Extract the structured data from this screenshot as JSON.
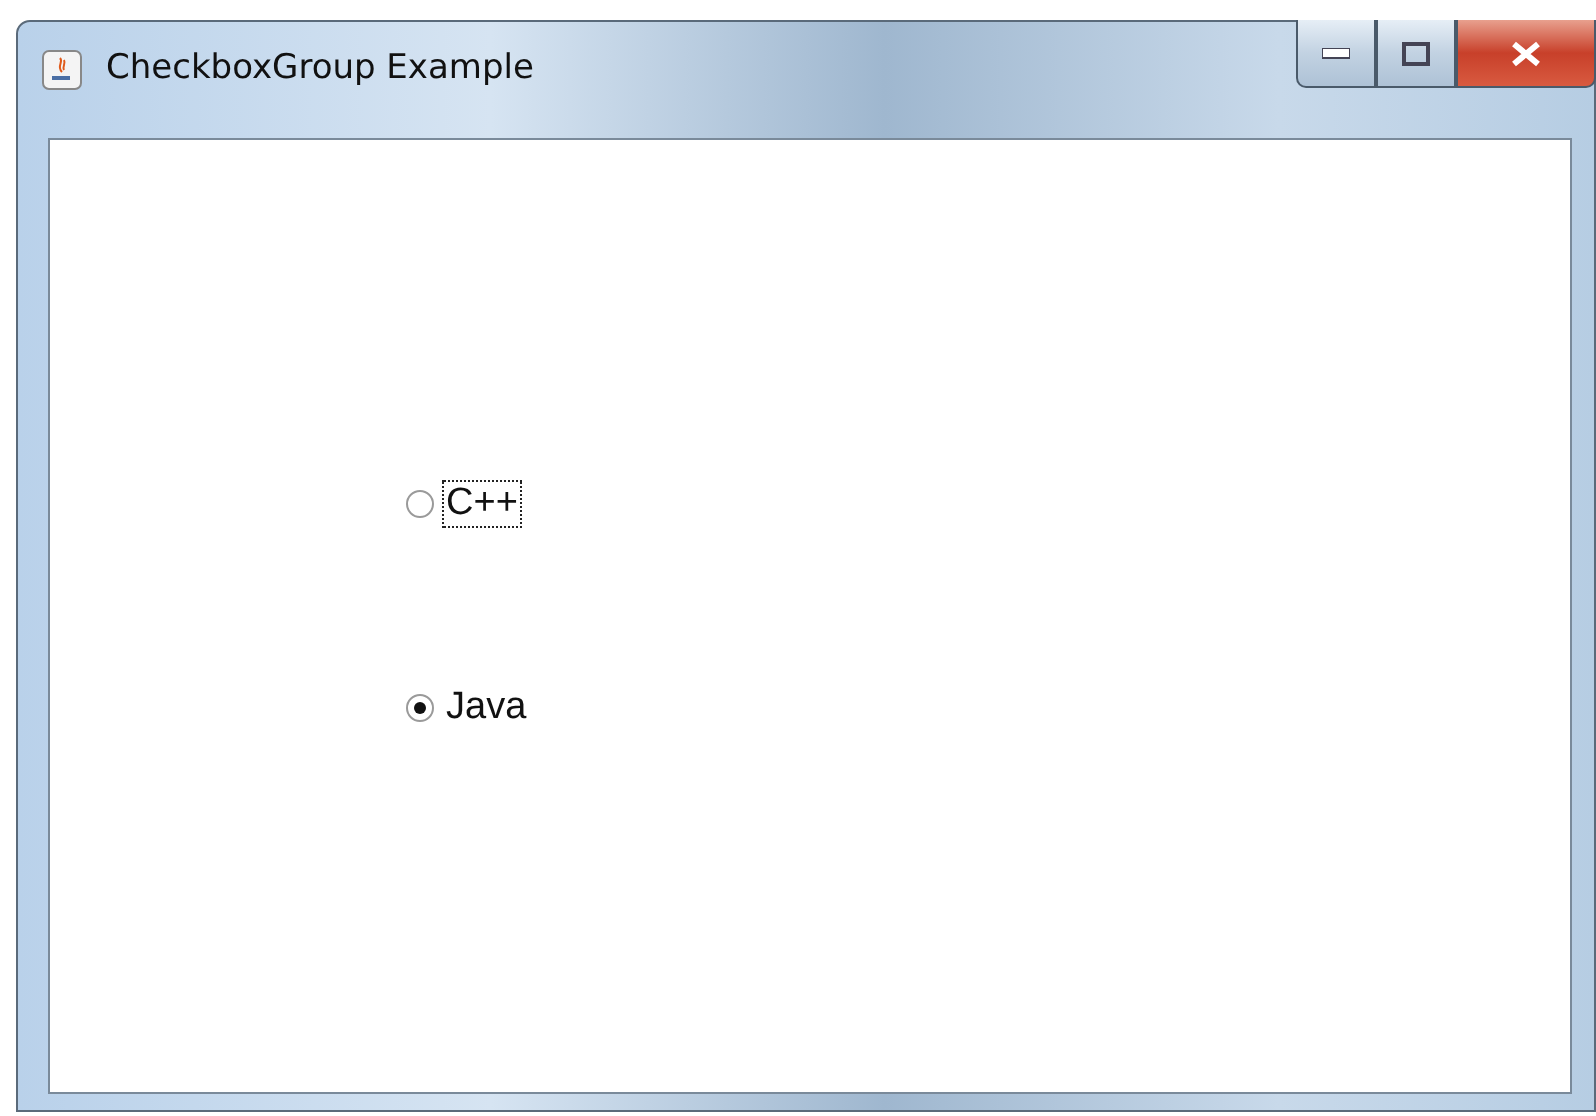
{
  "window": {
    "title": "CheckboxGroup Example"
  },
  "options": [
    {
      "label": "C++",
      "selected": false,
      "focused": true
    },
    {
      "label": "Java",
      "selected": true,
      "focused": false
    }
  ]
}
